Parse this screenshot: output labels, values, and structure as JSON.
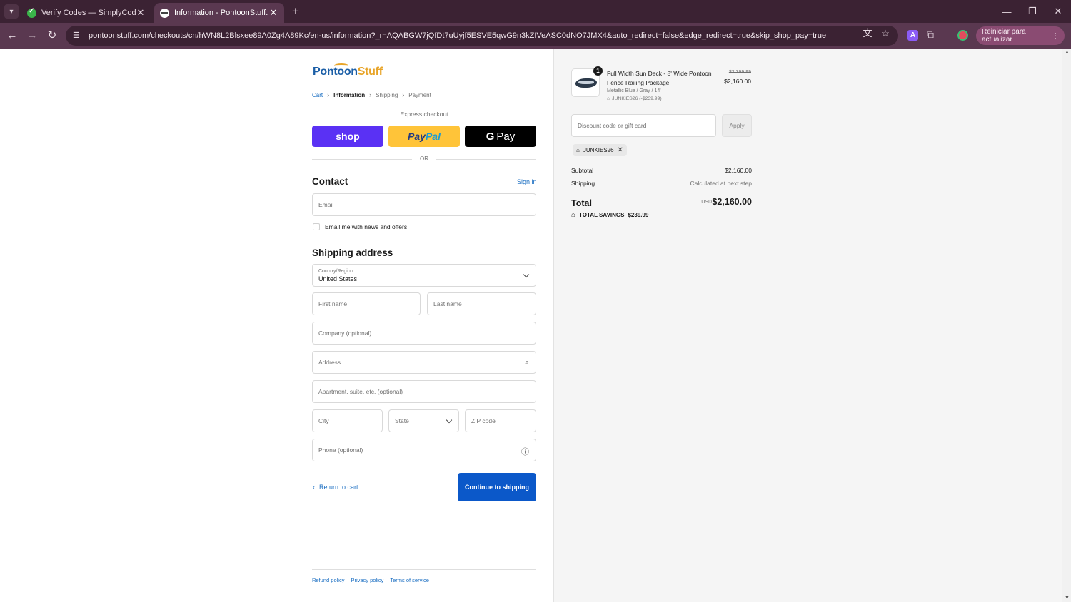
{
  "browser": {
    "tabs": [
      {
        "title": "Verify Codes — SimplyCodes"
      },
      {
        "title": "Information - PontoonStuff.com"
      }
    ],
    "url": "pontoonstuff.com/checkouts/cn/hWN8L2Blsxee89A0Zg4A89Kc/en-us/information?_r=AQABGW7jQfDt7uUyjf5ESVE5qwG9n3kZIVeASC0dNO7JMX4&auto_redirect=false&edge_redirect=true&skip_shop_pay=true",
    "relaunch_label": "Reiniciar para actualizar"
  },
  "brand": {
    "part1": "Pontoon",
    "part2": "Stuff",
    "colors": {
      "blue": "#1c5fa7",
      "orange": "#e8a427"
    }
  },
  "breadcrumb": [
    "Cart",
    "Information",
    "Shipping",
    "Payment"
  ],
  "express": {
    "label": "Express checkout",
    "shop": "shop",
    "paypal_a": "Pay",
    "paypal_b": "Pal",
    "gpay_g": "G",
    "gpay": "Pay",
    "or": "OR"
  },
  "contact": {
    "heading": "Contact",
    "signin": "Sign in",
    "email_placeholder": "Email",
    "newsletter": "Email me with news and offers"
  },
  "shipping": {
    "heading": "Shipping address",
    "country_label": "Country/Region",
    "country_value": "United States",
    "first_name": "First name",
    "last_name": "Last name",
    "company": "Company (optional)",
    "address": "Address",
    "apartment": "Apartment, suite, etc. (optional)",
    "city": "City",
    "state": "State",
    "zip": "ZIP code",
    "phone": "Phone (optional)"
  },
  "actions": {
    "return": "Return to cart",
    "continue": "Continue to shipping",
    "continue_color": "#0b58c9"
  },
  "footer": [
    "Refund policy",
    "Privacy policy",
    "Terms of service"
  ],
  "summary": {
    "product": {
      "quantity": "1",
      "name": "Full Width Sun Deck - 8' Wide Pontoon Fence Railing Package",
      "variant": "Metallic Blue / Gray / 14'",
      "discount": "JUNKIES26 (-$239.99)",
      "original_price": "$2,399.99",
      "price": "$2,160.00"
    },
    "discount_placeholder": "Discount code or gift card",
    "apply": "Apply",
    "applied_code": "JUNKIES26",
    "subtotal_label": "Subtotal",
    "subtotal": "$2,160.00",
    "shipping_label": "Shipping",
    "shipping_value": "Calculated at next step",
    "total_label": "Total",
    "currency": "USD",
    "total": "$2,160.00",
    "savings_label": "TOTAL SAVINGS",
    "savings": "$239.99"
  }
}
